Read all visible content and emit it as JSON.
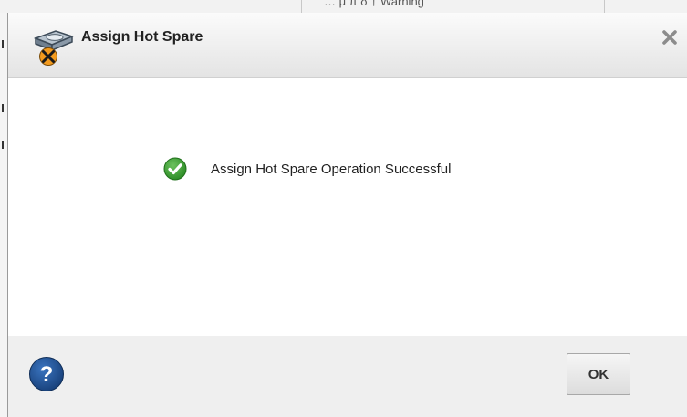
{
  "background": {
    "partial_text": "… μ π δ † Warning"
  },
  "dialog": {
    "title": "Assign Hot Spare",
    "title_icon": "hot-spare-drive-tools-icon",
    "close_icon": "close-icon",
    "message": "Assign Hot Spare Operation Successful",
    "status_icon": "success-check-icon",
    "status_color": "#3a9a2f",
    "help_icon": "help-icon",
    "help_color": "#1f4e8c",
    "ok_label": "OK"
  }
}
